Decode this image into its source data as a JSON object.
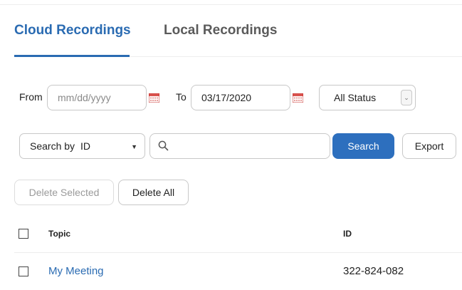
{
  "tabs": {
    "cloud_label": "Cloud Recordings",
    "local_label": "Local Recordings"
  },
  "filters": {
    "from_label": "From",
    "from_placeholder": "mm/dd/yyyy",
    "to_label": "To",
    "to_value": "03/17/2020",
    "status_selected": "All Status"
  },
  "search": {
    "by_label": "Search by",
    "by_selected": "ID",
    "query_value": "",
    "search_button": "Search",
    "export_button": "Export"
  },
  "actions": {
    "delete_selected": "Delete Selected",
    "delete_all": "Delete All"
  },
  "table": {
    "columns": [
      "Topic",
      "ID"
    ],
    "rows": [
      {
        "topic": "My Meeting",
        "id": "322-824-082"
      }
    ]
  },
  "colors": {
    "accent": "#2a6bb2",
    "primary_button": "#2d6fbe",
    "calendar_icon": "#d9534f"
  },
  "icons": {
    "calendar": "calendar-icon",
    "search": "search-icon",
    "caret": "chevron-down-icon"
  }
}
